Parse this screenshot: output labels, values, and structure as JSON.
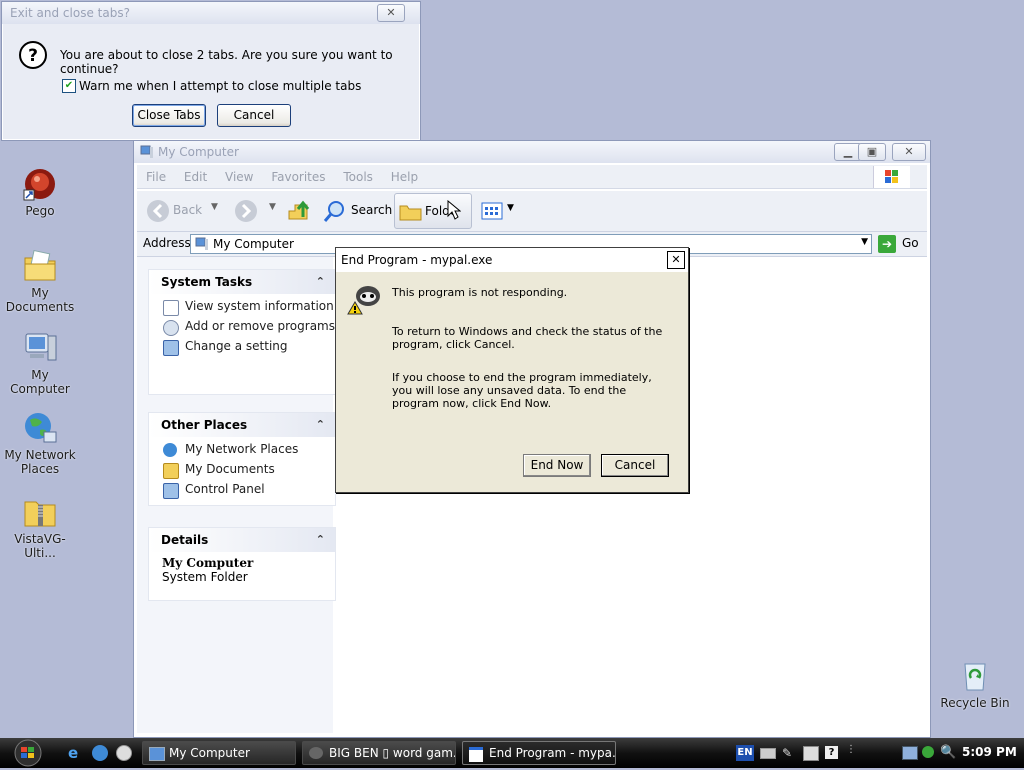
{
  "desktop": {
    "icons": [
      {
        "label": "Pego"
      },
      {
        "label": "My Documents"
      },
      {
        "label": "My Computer"
      },
      {
        "label": "My Network Places"
      },
      {
        "label": "VistaVG-Ulti..."
      },
      {
        "label": "Recycle Bin"
      }
    ]
  },
  "close_tabs_dialog": {
    "title": "Exit and close tabs?",
    "message": "You are about to close 2 tabs. Are you sure you want to continue?",
    "checkbox_label": "Warn me when I attempt to close multiple tabs",
    "checkbox_checked": true,
    "close_tabs_label": "Close Tabs",
    "cancel_label": "Cancel"
  },
  "explorer": {
    "title": "My Computer",
    "menu": [
      "File",
      "Edit",
      "View",
      "Favorites",
      "Tools",
      "Help"
    ],
    "toolbar": {
      "back": "Back",
      "search": "Search",
      "folders": "Folders"
    },
    "address_label": "Address",
    "address_value": "My Computer",
    "go_label": "Go",
    "system_tasks": {
      "title": "System Tasks",
      "items": [
        "View system information",
        "Add or remove programs",
        "Change a setting"
      ]
    },
    "other_places": {
      "title": "Other Places",
      "items": [
        "My Network Places",
        "My Documents",
        "Control Panel"
      ]
    },
    "details": {
      "title": "Details",
      "name": "My Computer",
      "type": "System Folder"
    }
  },
  "end_program_dialog": {
    "title": "End Program - mypal.exe",
    "line1": "This program is not responding.",
    "line2": "To return to Windows and check the status of the program, click Cancel.",
    "line3": "If you choose to end the program immediately, you will lose any unsaved data. To end the program now, click End Now.",
    "end_now_label": "End Now",
    "cancel_label": "Cancel"
  },
  "taskbar": {
    "tasks": [
      {
        "label": "My Computer"
      },
      {
        "label": "BIG BEN ▯ word gam..."
      },
      {
        "label": "End Program - mypa..."
      }
    ],
    "language": "EN",
    "clock": "5:09 PM"
  }
}
